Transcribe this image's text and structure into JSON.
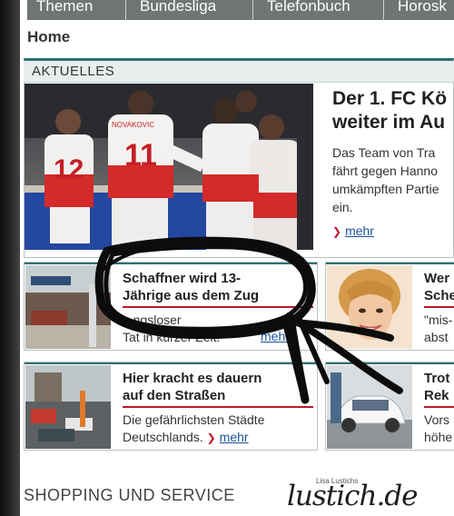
{
  "topnav": {
    "items": [
      "Themen",
      "Bundesliga",
      "Telefonbuch",
      "Horosk"
    ]
  },
  "breadcrumb": {
    "home": "Home"
  },
  "aktuelles": {
    "heading": "AKTUELLES",
    "lead": {
      "headline_lines": [
        "Der 1. FC Kö",
        "weiter im Au"
      ],
      "teaser_lines": [
        "Das Team von Tra",
        "fährt gegen Hanno",
        "umkämpften Partie",
        "ein."
      ],
      "more_label": "mehr"
    },
    "cards": [
      {
        "title_lines": [
          "Schaffner wird 13-",
          "Jährige aus dem Zug"
        ],
        "text_lines": [
          "...ngsloser",
          "Tat in kurzer Zeit."
        ],
        "more_label": "mehr"
      },
      {
        "title_lines": [
          "Wer",
          "Sche"
        ],
        "text_lines": [
          "\"mis-",
          "abst"
        ]
      },
      {
        "title_lines": [
          "Hier kracht es dauern",
          "auf den Straßen"
        ],
        "text_lines": [
          "Die gefährlichsten Städte",
          "Deutschlands."
        ],
        "more_label": "mehr"
      },
      {
        "title_lines": [
          "Trot",
          "Rek"
        ],
        "text_lines": [
          "Vors",
          "höhe"
        ]
      }
    ]
  },
  "section": {
    "title": "SHOPPING UND SERVICE"
  },
  "watermark": {
    "small": "Lisa Lustichs",
    "logo": "lustich.de"
  },
  "photo_text": {
    "jersey_number_1": "12",
    "jersey_number_2": "11",
    "player_name": "NOVAKOVIC"
  },
  "colors": {
    "nav_bg": "#6f7474",
    "accent_teal": "#2f6f72",
    "accent_red": "#c0182b",
    "link_blue": "#1a4f9c"
  }
}
